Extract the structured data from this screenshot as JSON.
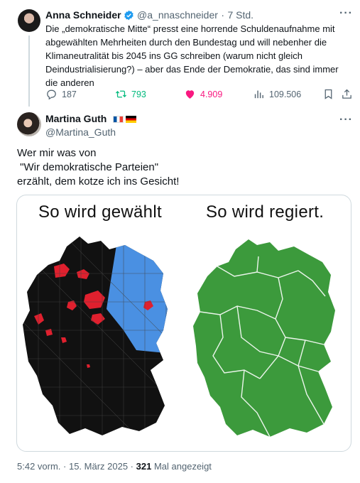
{
  "quoted_tweet": {
    "author_name": "Anna Schneider",
    "handle": "@a_nnaschneider",
    "separator": "·",
    "time": "7 Std.",
    "text": "Die „demokratische Mitte“ presst eine horrende Schuldenaufnahme mit abgewählten Mehrheiten durch den Bundestag und will nebenher die Klimaneutralität bis 2045 ins GG schreiben (warum nicht gleich Deindustrialisierung?) – aber das Ende der Demokratie, das sind immer die anderen",
    "replies": "187",
    "retweets": "793",
    "likes": "4.909",
    "views": "109.506",
    "more_label": "···"
  },
  "main_tweet": {
    "author_name": "Martina Guth",
    "handle": "@Martina_Guth",
    "more_label": "···",
    "text_lines": [
      "Wer mir was von",
      " \"Wir demokratische Parteien\"",
      "erzählt, dem kotze ich ins Gesicht!"
    ],
    "image": {
      "left_title": "So wird gewählt",
      "right_title": "So wird regiert."
    },
    "timestamp": "5:42 vorm. · 15. März 2025 ·",
    "view_count": "321",
    "view_label": "Mal angezeigt"
  },
  "colors": {
    "like": "#f91880",
    "retweet": "#00ba7c",
    "verified": "#1d9bf0",
    "map_black": "#111111",
    "map_blue": "#4a90e2",
    "map_red": "#e0202e",
    "map_green": "#3c9a3c"
  }
}
